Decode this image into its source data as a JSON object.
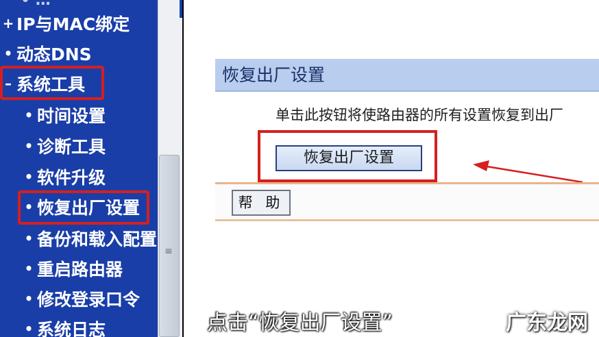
{
  "sidebar": {
    "top_partial": "• …",
    "items": [
      {
        "bullet": "+",
        "label": "IP与MAC绑定"
      },
      {
        "bullet": "•",
        "label": "动态DNS"
      },
      {
        "bullet": "–",
        "label": "系统工具"
      },
      {
        "bullet": "•",
        "label": "时间设置"
      },
      {
        "bullet": "•",
        "label": "诊断工具"
      },
      {
        "bullet": "•",
        "label": "软件升级"
      },
      {
        "bullet": "•",
        "label": "恢复出厂设置"
      },
      {
        "bullet": "•",
        "label": "备份和载入配置"
      },
      {
        "bullet": "•",
        "label": "重启路由器"
      },
      {
        "bullet": "•",
        "label": "修改登录口令"
      },
      {
        "bullet": "•",
        "label": "系统日志"
      }
    ]
  },
  "panel": {
    "title": "恢复出厂设置",
    "description": "单击此按钮将使路由器的所有设置恢复到出厂",
    "restore_button": "恢复出厂设置",
    "help_button": "帮 助"
  },
  "caption": "点击“恢复出厂设置”",
  "watermark": "广东龙网",
  "colors": {
    "sidebar_bg": "#1a3ea8",
    "highlight": "#d61f1f",
    "panel_title_bg": "#b9cdef"
  }
}
